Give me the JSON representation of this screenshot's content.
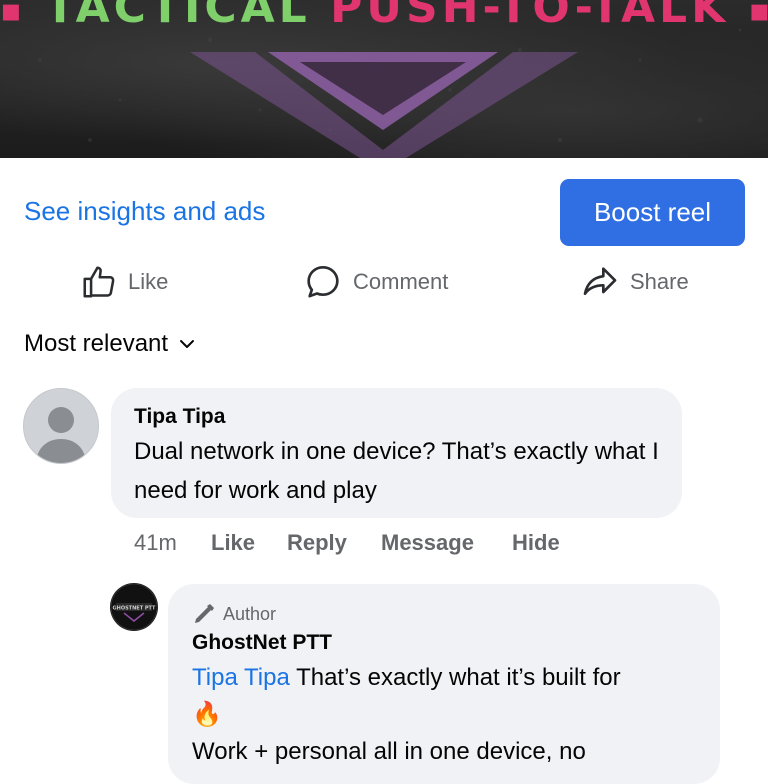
{
  "banner": {
    "title_left": "TACTICAL",
    "title_right": "PUSH-TO-TALK",
    "colors": {
      "green": "#7fcf6a",
      "pink": "#e0356f",
      "chevron": "#8e5fa4"
    }
  },
  "actions": {
    "insights_label": "See insights and ads",
    "boost_label": "Boost reel",
    "like_label": "Like",
    "comment_label": "Comment",
    "share_label": "Share"
  },
  "sort": {
    "label": "Most relevant",
    "icon": "chevron-down-icon"
  },
  "comment": {
    "author": "Tipa Tipa",
    "text": "Dual network in one device? That’s exactly what I need for work and play",
    "time": "41m",
    "actions": [
      "Like",
      "Reply",
      "Message",
      "Hide"
    ]
  },
  "reply": {
    "badge": "Author",
    "author": "GhostNet PTT",
    "avatar_text": "GHOSTNET PTT",
    "mention": "Tipa Tipa",
    "text_1": " That’s exactly what it’s built for",
    "emoji": "🔥",
    "text_2": "Work + personal all in one device, no"
  },
  "colors": {
    "accent": "#1b74e4",
    "button_bg": "#2f6fe3",
    "bubble_bg": "#f0f2f5",
    "secondary_text": "#65676b"
  }
}
